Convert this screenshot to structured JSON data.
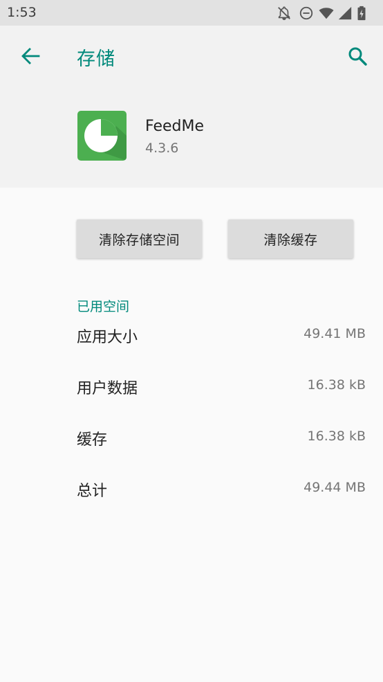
{
  "status_bar": {
    "time": "1:53",
    "icons": [
      "notifications-off-icon",
      "do-not-disturb-icon",
      "wifi-icon",
      "signal-icon",
      "battery-charging-icon"
    ]
  },
  "toolbar": {
    "title": "存储",
    "back_icon": "arrow-back-icon",
    "search_icon": "search-icon",
    "accent_color": "#00897b"
  },
  "app": {
    "name": "FeedMe",
    "version": "4.3.6",
    "icon": "pie-chart-app-icon",
    "icon_color": "#4caf50"
  },
  "actions": {
    "clear_storage": "清除存储空间",
    "clear_cache": "清除缓存"
  },
  "storage": {
    "section_title": "已用空间",
    "rows": [
      {
        "label": "应用大小",
        "value": "49.41 MB"
      },
      {
        "label": "用户数据",
        "value": "16.38 kB"
      },
      {
        "label": "缓存",
        "value": "16.38 kB"
      },
      {
        "label": "总计",
        "value": "49.44 MB"
      }
    ]
  }
}
